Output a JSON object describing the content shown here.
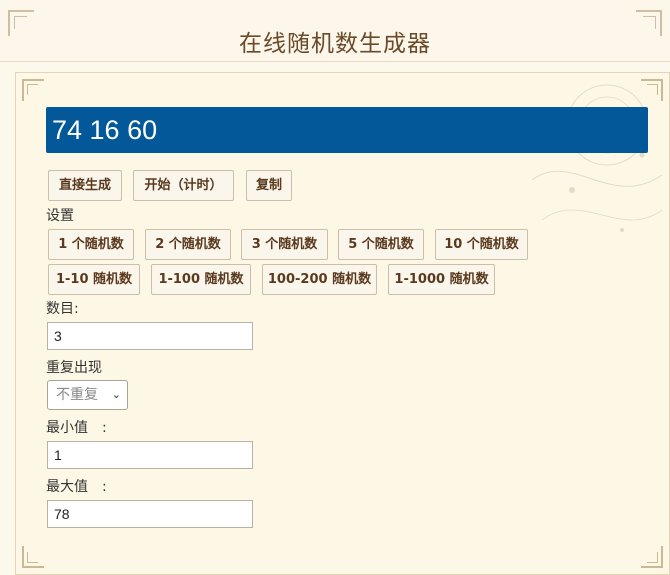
{
  "header": {
    "title": "在线随机数生成器"
  },
  "result": {
    "value": "74 16 60"
  },
  "actions": {
    "generate": "直接生成",
    "start": "开始（计时）",
    "copy": "复制"
  },
  "settings": {
    "label": "设置",
    "presets_row1": [
      "1 个随机数",
      "2 个随机数",
      "3 个随机数",
      "5 个随机数",
      "10 个随机数"
    ],
    "presets_row2": [
      "1-10 随机数",
      "1-100 随机数",
      "100-200 随机数",
      "1-1000 随机数"
    ]
  },
  "form": {
    "count_label": "数目:",
    "count_value": "3",
    "repeat_label": "重复出现",
    "repeat_selected": "不重复",
    "min_label": "最小值　:",
    "min_value": "1",
    "max_label": "最大值　:",
    "max_value": "78"
  },
  "colors": {
    "result_bg": "#03589a",
    "button_text": "#5a3a1e",
    "title": "#6b4a2a"
  }
}
